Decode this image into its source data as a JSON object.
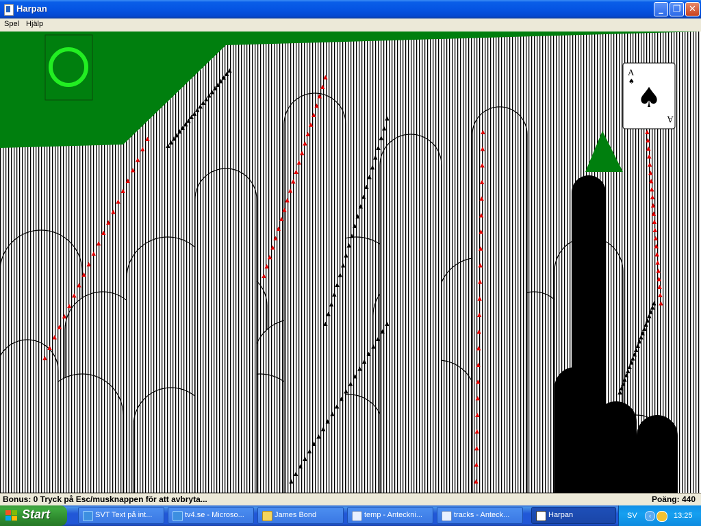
{
  "window": {
    "title": "Harpan",
    "minimize_glyph": "_",
    "maximize_glyph": "❐",
    "close_glyph": "✕"
  },
  "menu": {
    "items": [
      "Spel",
      "Hjälp"
    ]
  },
  "game": {
    "felt_color": "#007f0e",
    "card_rank_shown": "A",
    "card_suit_shown": "spade-icon"
  },
  "status": {
    "left": "Bonus: 0  Tryck på Esc/musknappen för att avbryta...",
    "right": "Poäng: 440"
  },
  "taskbar": {
    "start_label": "Start",
    "tasks": [
      {
        "label": "SVT Text på int...",
        "icon": "ie-icon"
      },
      {
        "label": "tv4.se - Microso...",
        "icon": "ie-icon"
      },
      {
        "label": "James Bond",
        "icon": "folder-icon"
      },
      {
        "label": "temp - Anteckni...",
        "icon": "notepad-icon"
      },
      {
        "label": "tracks - Anteck...",
        "icon": "notepad-icon"
      },
      {
        "label": "Harpan",
        "icon": "cards-icon"
      }
    ],
    "tray": {
      "language": "SV",
      "clock": "13:25"
    }
  }
}
